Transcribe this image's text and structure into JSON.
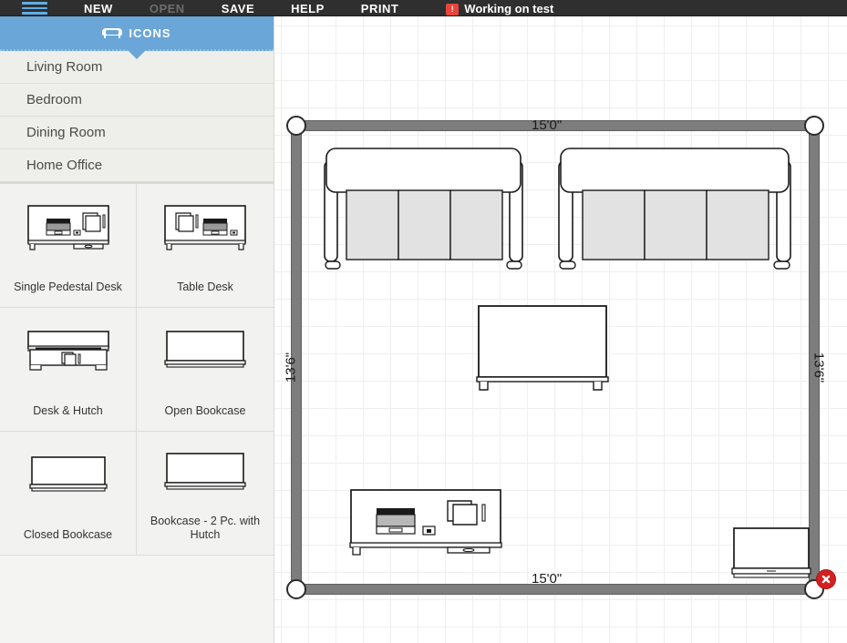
{
  "topbar": {
    "menu_icon": "hamburger-icon",
    "items": [
      {
        "label": "NEW",
        "enabled": true
      },
      {
        "label": "OPEN",
        "enabled": false
      },
      {
        "label": "SAVE",
        "enabled": true
      },
      {
        "label": "HELP",
        "enabled": true
      },
      {
        "label": "PRINT",
        "enabled": true
      }
    ],
    "status_badge": "!",
    "status_text": "Working on test",
    "badge_color": "#e8453c",
    "background_color": "#2f2f2f"
  },
  "sidebar": {
    "tab": {
      "label": "ICONS",
      "icon": "sofa-icon",
      "color": "#6aa6d8"
    },
    "categories": [
      {
        "label": "Living Room"
      },
      {
        "label": "Bedroom"
      },
      {
        "label": "Dining Room"
      },
      {
        "label": "Home Office"
      }
    ],
    "items": [
      {
        "label": "Single Pedestal Desk",
        "icon": "desk-with-laptop-icon"
      },
      {
        "label": "Table Desk",
        "icon": "table-desk-icon"
      },
      {
        "label": "Desk & Hutch",
        "icon": "desk-hutch-icon"
      },
      {
        "label": "Open Bookcase",
        "icon": "open-bookcase-icon"
      },
      {
        "label": "Closed Bookcase",
        "icon": "closed-bookcase-icon"
      },
      {
        "label": "Bookcase - 2 Pc. with Hutch",
        "icon": "bookcase-hutch-icon"
      }
    ]
  },
  "canvas": {
    "grid_size_px": 30,
    "grid_color": "#efefef",
    "wall_color": "#7d7d7d",
    "dimensions": {
      "top": "15'0\"",
      "bottom": "15'0\"",
      "left": "13'6\"",
      "right": "13'6\""
    },
    "corner_handles": 4,
    "delete_button": {
      "name": "delete-room-button",
      "glyph": "✕",
      "color": "#d32020"
    },
    "furniture": [
      {
        "name": "sofa-left",
        "type": "sofa",
        "cushions": 3
      },
      {
        "name": "sofa-right",
        "type": "sofa",
        "cushions": 3
      },
      {
        "name": "coffee-table",
        "type": "table"
      },
      {
        "name": "desk-with-laptop",
        "type": "desk"
      },
      {
        "name": "bookcase",
        "type": "bookcase"
      }
    ]
  }
}
